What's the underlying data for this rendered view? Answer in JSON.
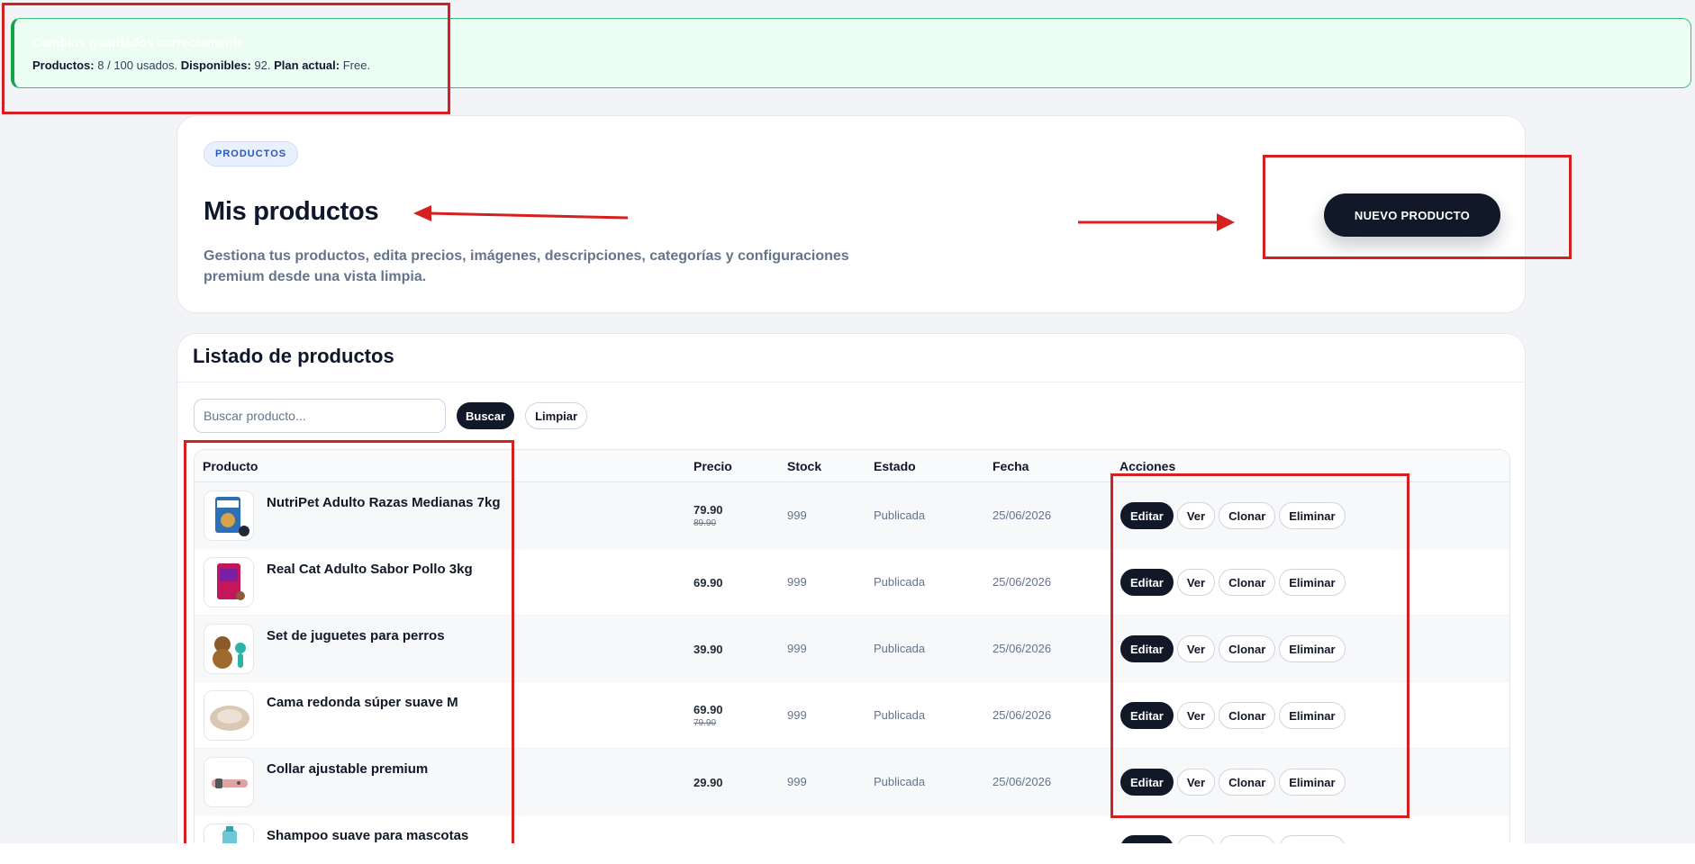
{
  "notice": {
    "title": "Cambios guardados correctamente",
    "productos_label": "Productos:",
    "productos_value": "8 / 100 usados.",
    "disponibles_label": "Disponibles:",
    "disponibles_value": "92.",
    "plan_label": "Plan actual:",
    "plan_value": "Free."
  },
  "hero": {
    "badge": "PRODUCTOS",
    "title": "Mis productos",
    "description": "Gestiona tus productos, edita precios, imágenes, descripciones, categorías y configuraciones premium desde una vista limpia.",
    "new_button": "NUEVO PRODUCTO"
  },
  "list": {
    "title": "Listado de productos",
    "search_placeholder": "Buscar producto...",
    "search_button": "Buscar",
    "clear_button": "Limpiar",
    "columns": [
      "Producto",
      "Precio",
      "Stock",
      "Estado",
      "Fecha",
      "Acciones"
    ],
    "actions": [
      "Editar",
      "Ver",
      "Clonar",
      "Eliminar"
    ],
    "rows": [
      {
        "name": "NutriPet Adulto Razas Medianas 7kg",
        "price": "79.90",
        "old_price": "89.90",
        "stock": "999",
        "status": "Publicada",
        "date": "25/06/2026",
        "thumb_icon": "dog-food-bag-icon"
      },
      {
        "name": "Real Cat Adulto Sabor Pollo 3kg",
        "price": "69.90",
        "old_price": "",
        "stock": "999",
        "status": "Publicada",
        "date": "25/06/2026",
        "thumb_icon": "cat-food-bag-icon"
      },
      {
        "name": "Set de juguetes para perros",
        "price": "39.90",
        "old_price": "",
        "stock": "999",
        "status": "Publicada",
        "date": "25/06/2026",
        "thumb_icon": "dog-toys-icon"
      },
      {
        "name": "Cama redonda súper suave M",
        "price": "69.90",
        "old_price": "79.90",
        "stock": "999",
        "status": "Publicada",
        "date": "25/06/2026",
        "thumb_icon": "round-bed-icon"
      },
      {
        "name": "Collar ajustable premium",
        "price": "29.90",
        "old_price": "",
        "stock": "999",
        "status": "Publicada",
        "date": "25/06/2026",
        "thumb_icon": "collar-icon"
      },
      {
        "name": "Shampoo suave para mascotas",
        "price": "",
        "old_price": "",
        "stock": "",
        "status": "",
        "date": "",
        "thumb_icon": "shampoo-bottle-icon"
      }
    ]
  },
  "colors": {
    "accent_dark": "#111827",
    "notice_green": "#16a34a",
    "annotation_red": "#d42020",
    "badge_blue": "#2456c4"
  }
}
